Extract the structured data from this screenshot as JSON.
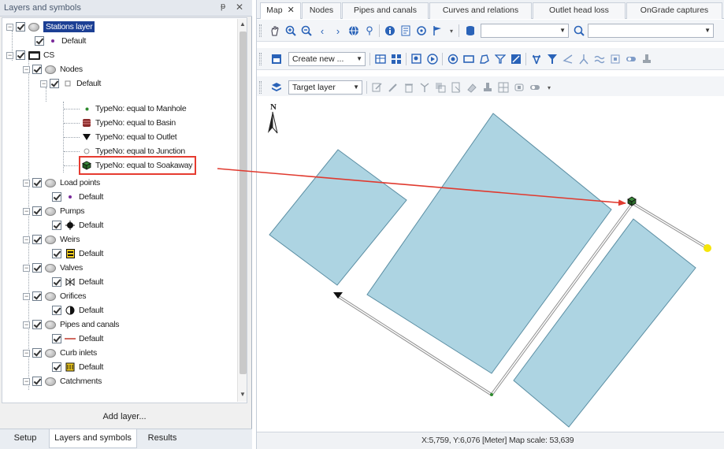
{
  "panel": {
    "title": "Layers and symbols",
    "pin": "ᵽ",
    "close": "✕",
    "add_layer": "Add layer...",
    "bottom_tabs": [
      "Setup",
      "Layers and symbols",
      "Results"
    ]
  },
  "tree": {
    "stations_layer": "Stations layer",
    "stations_default": "Default",
    "cs": "CS",
    "nodes": "Nodes",
    "nodes_default": "Default",
    "node_rules": [
      "TypeNo: equal to Manhole",
      "TypeNo: equal to Basin",
      "TypeNo: equal to Outlet",
      "TypeNo: equal to Junction",
      "TypeNo: equal to Soakaway"
    ],
    "load_points": "Load points",
    "pumps": "Pumps",
    "weirs": "Weirs",
    "valves": "Valves",
    "orifices": "Orifices",
    "pipes_and_canals": "Pipes and canals",
    "curb_inlets": "Curb inlets",
    "catchments": "Catchments",
    "default": "Default"
  },
  "doc_tabs": [
    "Map",
    "Nodes",
    "Pipes and canals",
    "Curves and relations",
    "Outlet head loss",
    "OnGrade captures"
  ],
  "toolbar": {
    "create_new": "Create new ...",
    "target_layer": "Target layer"
  },
  "map": {
    "north_label": "N",
    "polygon_fill": "#a9d2e0",
    "polygon_stroke": "#5b8ea3",
    "annotation_color": "#e03a2f",
    "junction_color": "#f5e50a"
  },
  "status": {
    "text": "X:5,759, Y:6,076 [Meter]   Map scale: 53,639"
  },
  "colors": {
    "selection": "#1c3f94",
    "accent": "#e63b30"
  }
}
